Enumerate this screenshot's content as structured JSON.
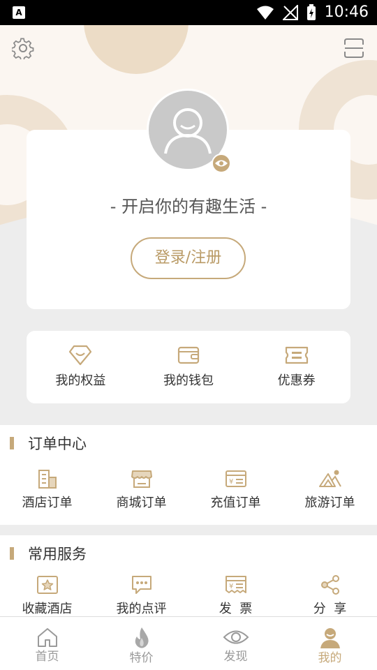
{
  "status_bar": {
    "time": "10:46",
    "notification_icon": "A"
  },
  "header": {
    "settings_icon": "gear-icon",
    "scan_icon": "scan-icon"
  },
  "profile": {
    "slogan": "- 开启你的有趣生活 -",
    "login_label": "登录/注册"
  },
  "quick": [
    {
      "label": "我的权益",
      "icon": "rights-icon"
    },
    {
      "label": "我的钱包",
      "icon": "wallet-icon"
    },
    {
      "label": "优惠券",
      "icon": "coupon-icon"
    }
  ],
  "orders": {
    "title": "订单中心",
    "items": [
      {
        "label": "酒店订单",
        "icon": "hotel-icon"
      },
      {
        "label": "商城订单",
        "icon": "store-icon"
      },
      {
        "label": "充值订单",
        "icon": "recharge-icon"
      },
      {
        "label": "旅游订单",
        "icon": "travel-icon"
      }
    ]
  },
  "services": {
    "title": "常用服务",
    "items": [
      {
        "label": "收藏酒店",
        "icon": "favorite-icon"
      },
      {
        "label": "我的点评",
        "icon": "review-icon"
      },
      {
        "label": "发  票",
        "icon": "invoice-icon"
      },
      {
        "label": "分  享",
        "icon": "share-icon"
      }
    ]
  },
  "tabs": [
    {
      "label": "首页",
      "icon": "home-icon",
      "active": false
    },
    {
      "label": "特价",
      "icon": "flame-icon",
      "active": false
    },
    {
      "label": "发现",
      "icon": "eye-icon",
      "active": false
    },
    {
      "label": "我的",
      "icon": "user-icon",
      "active": true
    }
  ],
  "colors": {
    "accent": "#c6a97a",
    "hero_bg": "#fbf6f1",
    "page_bg": "#ededed"
  }
}
